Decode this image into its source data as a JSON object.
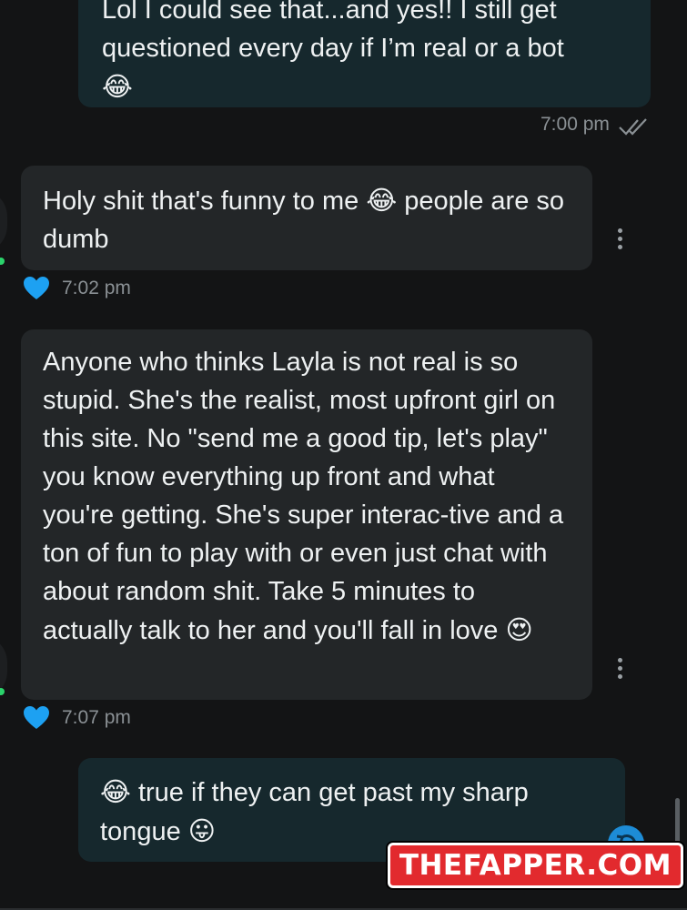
{
  "messages": [
    {
      "direction": "outgoing",
      "text": "Lol I could see that...and yes!! I still get questioned every day if I’m real or a bot",
      "emoji": "😂",
      "time": "7:00 pm",
      "status": "read-double-check"
    },
    {
      "direction": "incoming",
      "text_before": "Holy shit that's funny to me",
      "emoji": "😂",
      "text_after": "people are so dumb",
      "time": "7:02 pm",
      "reaction": "heart"
    },
    {
      "direction": "incoming",
      "text": "Anyone who thinks Layla is not real is so stupid. She's the realist, most upfront girl on this site. No \"send me a good tip, let's play\" you know everything up front and what you're getting. She's super interac-tive and a ton of fun to play with or even just chat with about random shit. Take 5 minutes to actually talk to her and you'll fall in love",
      "emoji": "😍",
      "time": "7:07 pm",
      "reaction": "heart"
    },
    {
      "direction": "outgoing",
      "emoji_before": "😂",
      "text": "true if they can get past my sharp tongue",
      "emoji": "😛"
    }
  ],
  "watermark": "THEFAPPER.COM",
  "colors": {
    "background": "#131415",
    "outgoing_bubble": "#16282d",
    "incoming_bubble": "#232628",
    "heart": "#1da1f2",
    "online": "#2bd36b",
    "watermark_bg": "#e22a2e"
  }
}
